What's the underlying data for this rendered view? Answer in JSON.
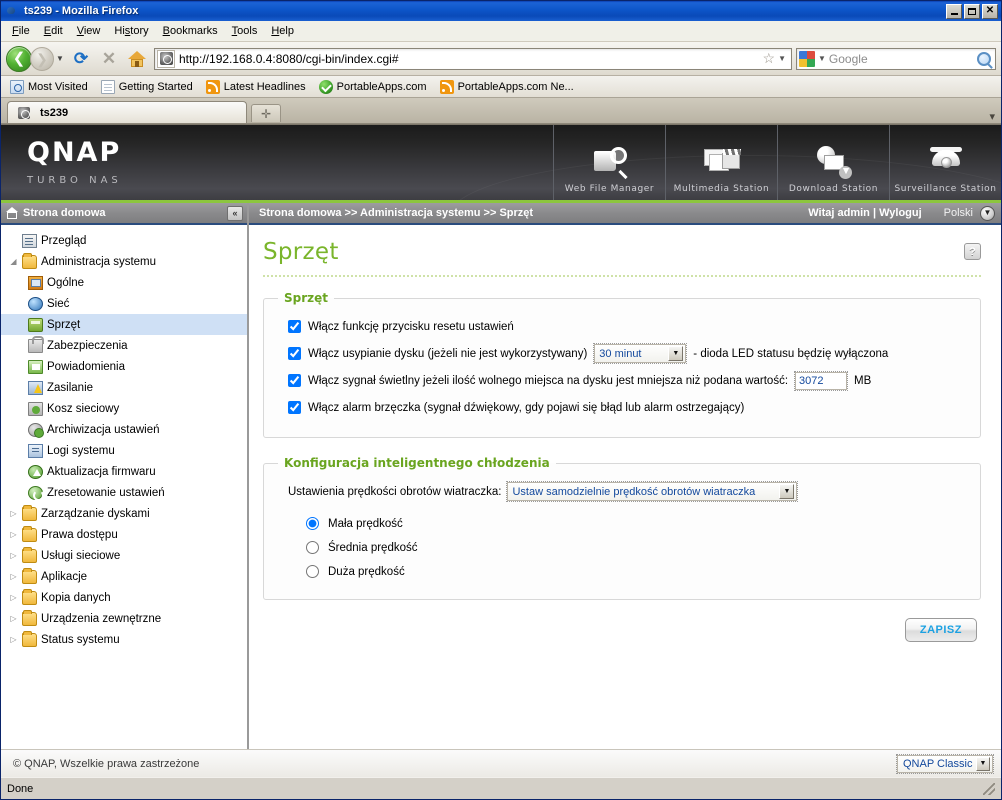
{
  "window": {
    "title": "ts239 - Mozilla Firefox",
    "app_icon": "firefox-icon",
    "minimize": "_",
    "maximize": "□",
    "close": "✕"
  },
  "menubar": {
    "items": [
      "File",
      "Edit",
      "View",
      "History",
      "Bookmarks",
      "Tools",
      "Help"
    ]
  },
  "navbar": {
    "back_glyph": "❮",
    "forward_glyph": "❯",
    "dropdown_glyph": "▼",
    "reload_glyph": "⟳",
    "stop_glyph": "✕",
    "url": "http://192.168.0.4:8080/cgi-bin/index.cgi#",
    "star_glyph": "☆",
    "search_placeholder": "Google",
    "search_value": ""
  },
  "bookmarks": {
    "items": [
      {
        "label": "Most Visited",
        "icon": "most-visited-icon"
      },
      {
        "label": "Getting Started",
        "icon": "page-icon"
      },
      {
        "label": "Latest Headlines",
        "icon": "rss-icon"
      },
      {
        "label": "PortableApps.com",
        "icon": "portableapps-icon"
      },
      {
        "label": "PortableApps.com Ne...",
        "icon": "rss-icon"
      }
    ]
  },
  "tabs": {
    "active": "ts239",
    "new_tab_glyph": "✛",
    "list_glyph": "▾"
  },
  "banner": {
    "logo": "QNAP",
    "tagline": "TURBO NAS",
    "nav": [
      {
        "label": "Web File Manager",
        "icon": "web-file-manager-icon"
      },
      {
        "label": "Multimedia Station",
        "icon": "multimedia-station-icon"
      },
      {
        "label": "Download Station",
        "icon": "download-station-icon"
      },
      {
        "label": "Surveillance Station",
        "icon": "surveillance-station-icon"
      }
    ]
  },
  "sidebar": {
    "header": "Strona domowa",
    "collapse_glyph": "«",
    "items": [
      {
        "label": "Przegląd",
        "level": 1,
        "icon": "overview-icon",
        "twist": "",
        "selected": false
      },
      {
        "label": "Administracja systemu",
        "level": 1,
        "icon": "folder-icon",
        "twist": "◢",
        "selected": false
      },
      {
        "label": "Ogólne",
        "level": 2,
        "icon": "general-icon",
        "twist": "",
        "selected": false
      },
      {
        "label": "Sieć",
        "level": 2,
        "icon": "network-icon",
        "twist": "",
        "selected": false
      },
      {
        "label": "Sprzęt",
        "level": 2,
        "icon": "hardware-icon",
        "twist": "",
        "selected": true
      },
      {
        "label": "Zabezpieczenia",
        "level": 2,
        "icon": "lock-icon",
        "twist": "",
        "selected": false
      },
      {
        "label": "Powiadomienia",
        "level": 2,
        "icon": "notification-icon",
        "twist": "",
        "selected": false
      },
      {
        "label": "Zasilanie",
        "level": 2,
        "icon": "power-icon",
        "twist": "",
        "selected": false
      },
      {
        "label": "Kosz sieciowy",
        "level": 2,
        "icon": "trash-icon",
        "twist": "",
        "selected": false
      },
      {
        "label": "Archiwizacja ustawień",
        "level": 2,
        "icon": "backup-icon",
        "twist": "",
        "selected": false
      },
      {
        "label": "Logi systemu",
        "level": 2,
        "icon": "logs-icon",
        "twist": "",
        "selected": false
      },
      {
        "label": "Aktualizacja firmwaru",
        "level": 2,
        "icon": "firmware-icon",
        "twist": "",
        "selected": false
      },
      {
        "label": "Zresetowanie ustawień",
        "level": 2,
        "icon": "reset-icon",
        "twist": "",
        "selected": false
      },
      {
        "label": "Zarządzanie dyskami",
        "level": 1,
        "icon": "folder-icon",
        "twist": "▷",
        "selected": false
      },
      {
        "label": "Prawa dostępu",
        "level": 1,
        "icon": "folder-icon",
        "twist": "▷",
        "selected": false
      },
      {
        "label": "Usługi sieciowe",
        "level": 1,
        "icon": "folder-icon",
        "twist": "▷",
        "selected": false
      },
      {
        "label": "Aplikacje",
        "level": 1,
        "icon": "folder-icon",
        "twist": "▷",
        "selected": false
      },
      {
        "label": "Kopia danych",
        "level": 1,
        "icon": "folder-icon",
        "twist": "▷",
        "selected": false
      },
      {
        "label": "Urządzenia zewnętrzne",
        "level": 1,
        "icon": "folder-icon",
        "twist": "▷",
        "selected": false
      },
      {
        "label": "Status systemu",
        "level": 1,
        "icon": "folder-icon",
        "twist": "▷",
        "selected": false
      }
    ]
  },
  "crumbbar": {
    "breadcrumb": "Strona domowa >> Administracja systemu >> Sprzęt",
    "greeting": "Witaj admin | Wyloguj",
    "language": "Polski",
    "language_arrow": "▼"
  },
  "page": {
    "title": "Sprzęt",
    "help_glyph": "?",
    "hardware_section": {
      "legend": "Sprzęt",
      "checkbox_reset": {
        "label": "Włącz funkcję przycisku resetu ustawień",
        "checked": true
      },
      "checkbox_standby": {
        "label_before": "Włącz usypianie dysku (jeżeli nie jest wykorzystywany)",
        "checked": true,
        "select_value": "30 minut",
        "select_arrow": "▼",
        "label_after": "- dioda LED statusu będzię wyłączona"
      },
      "checkbox_lowspace": {
        "label_before": "Włącz sygnał świetlny jeżeli ilość wolnego miejsca na dysku jest mniejsza niż podana wartość:",
        "checked": true,
        "input_value": "3072",
        "unit": "MB"
      },
      "checkbox_buzzer": {
        "label": "Włącz alarm brzęczka (sygnał dźwiękowy, gdy pojawi się błąd lub alarm ostrzegający)",
        "checked": true
      }
    },
    "cooling_section": {
      "legend": "Konfiguracja inteligentnego chłodzenia",
      "fan_label": "Ustawienia prędkości obrotów wiatraczka:",
      "fan_select_value": "Ustaw samodzielnie prędkość obrotów wiatraczka",
      "fan_select_arrow": "▼",
      "radios": [
        {
          "label": "Mała prędkość",
          "checked": true
        },
        {
          "label": "Średnia prędkość",
          "checked": false
        },
        {
          "label": "Duża prędkość",
          "checked": false
        }
      ]
    },
    "save_button": "ZAPISZ"
  },
  "page_footer": {
    "copyright": "© QNAP, Wszelkie prawa zastrzeżone",
    "theme": "QNAP Classic",
    "theme_arrow": "▼"
  },
  "statusbar": {
    "text": "Done"
  }
}
